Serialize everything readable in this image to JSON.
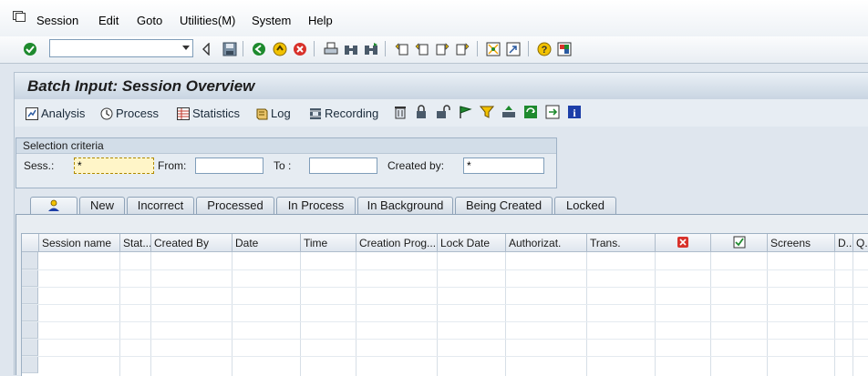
{
  "menu": {
    "items": [
      {
        "label": "Session",
        "accel": "S"
      },
      {
        "label": "Edit",
        "accel": "E"
      },
      {
        "label": "Goto",
        "accel": "G"
      },
      {
        "label": "Utilities(M)",
        "accel": ""
      },
      {
        "label": "System",
        "accel": "y"
      },
      {
        "label": "Help",
        "accel": "H"
      }
    ]
  },
  "toolbar": {
    "command_field": {
      "value": ""
    },
    "icons": [
      "enter-icon",
      "back-icon",
      "save-icon",
      "back-green-icon",
      "exit-icon",
      "cancel-icon",
      "print-icon",
      "find-icon",
      "find-next-icon",
      "first-page-icon",
      "previous-page-icon",
      "next-page-icon",
      "last-page-icon",
      "create-session-icon",
      "shortcut-icon",
      "help-icon",
      "layout-icon"
    ]
  },
  "title": "Batch Input: Session Overview",
  "app_toolbar": {
    "buttons": [
      {
        "label": "Analysis",
        "icon": "analysis-icon"
      },
      {
        "label": "Process",
        "icon": "process-icon"
      },
      {
        "label": "Statistics",
        "icon": "statistics-icon"
      },
      {
        "label": "Log",
        "icon": "log-icon"
      },
      {
        "label": "Recording",
        "icon": "recording-icon"
      }
    ],
    "icons": [
      "delete-icon",
      "lock-icon",
      "unlock-icon",
      "flag-icon",
      "filter-icon",
      "print-list-icon",
      "refresh-icon",
      "export-icon",
      "info-icon"
    ]
  },
  "selection": {
    "title": "Selection criteria",
    "session_label": "Sess.:",
    "session_value": "*",
    "from_label": "From:",
    "from_value": "",
    "to_label": "To :",
    "to_value": "",
    "created_by_label": "Created by:",
    "created_by_value": "*"
  },
  "tabs": [
    {
      "label": "",
      "icon": "all-sessions-icon",
      "active": true
    },
    {
      "label": "New"
    },
    {
      "label": "Incorrect"
    },
    {
      "label": "Processed"
    },
    {
      "label": "In Process"
    },
    {
      "label": "In Background"
    },
    {
      "label": "Being Created"
    },
    {
      "label": "Locked"
    }
  ],
  "table": {
    "columns": [
      "Session name",
      "Stat...",
      "Created By",
      "Date",
      "Time",
      "Creation Prog...",
      "Lock Date",
      "Authorizat.",
      "Trans.",
      "",
      "",
      "Screens",
      "D...",
      "Q..."
    ],
    "header_icons": {
      "9": "error-icon",
      "10": "checkmark-icon"
    },
    "rows": []
  },
  "colors": {
    "background": "#dfe6ee",
    "focus_field": "#fff5c8",
    "accent_green": "#1e8a2e",
    "accent_red": "#d8322b",
    "accent_yellow": "#f2c200"
  }
}
